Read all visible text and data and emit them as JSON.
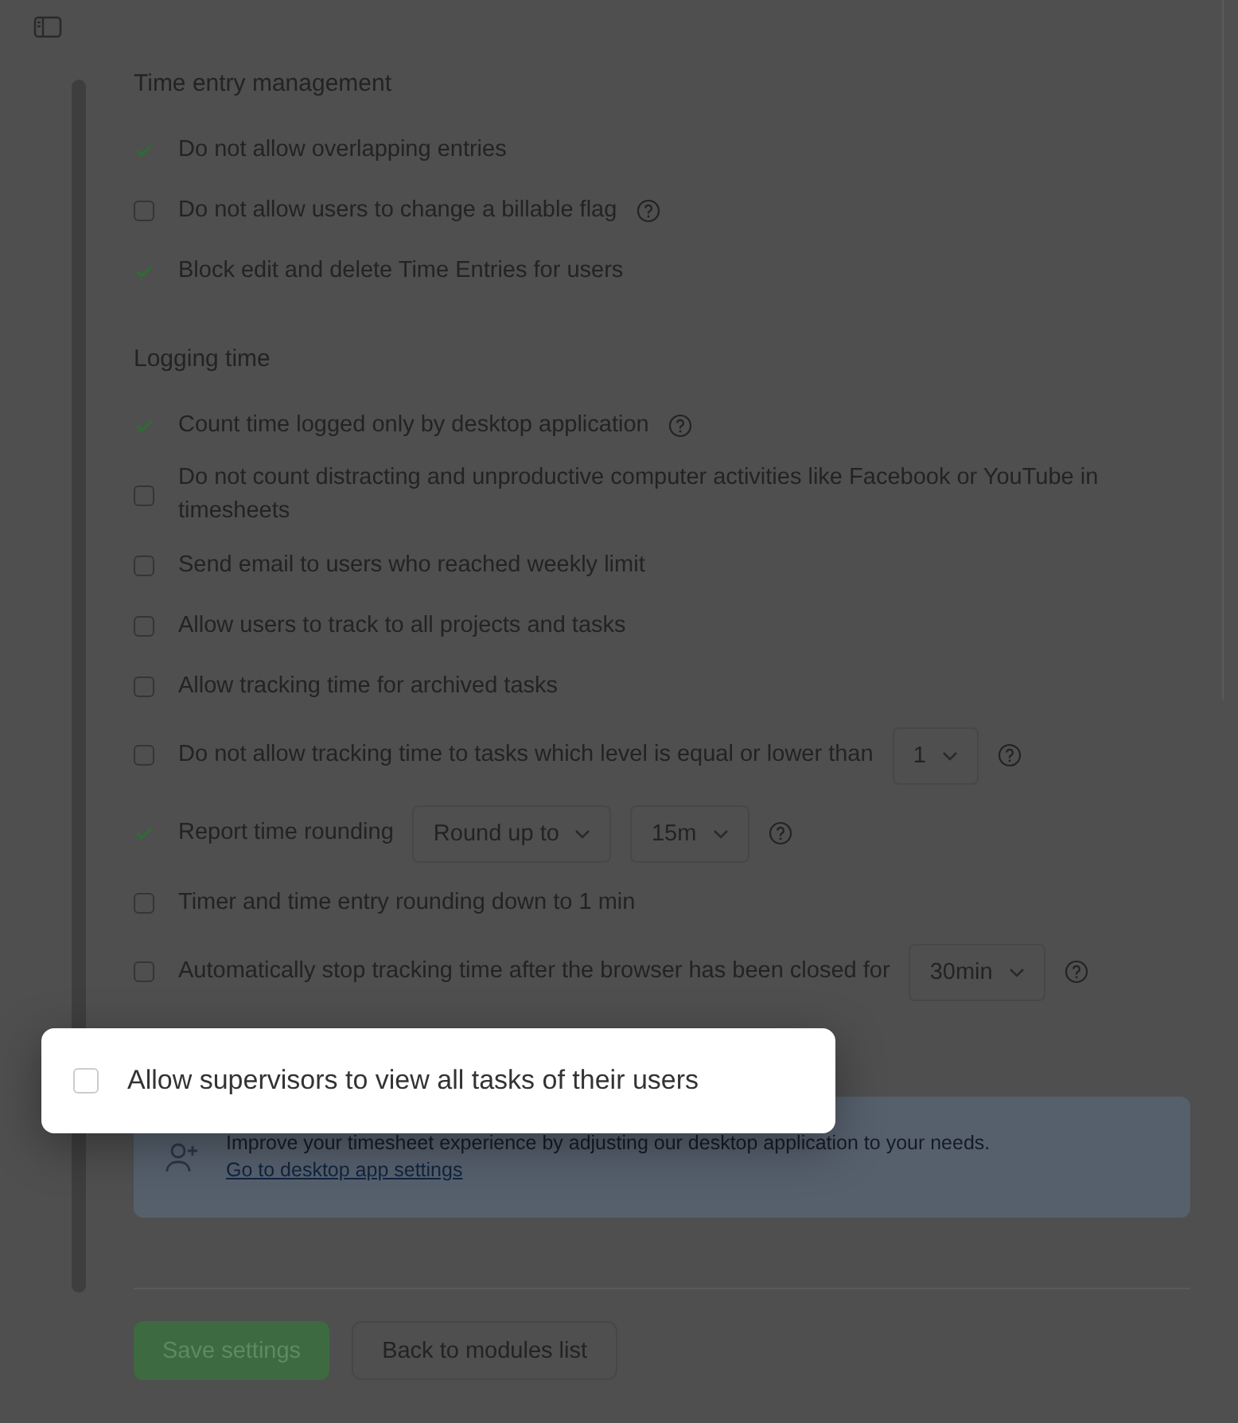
{
  "sections": [
    {
      "title": "Time entry management",
      "items": [
        {
          "label": "Do not allow overlapping entries",
          "checked": true
        },
        {
          "label": "Do not allow users to change a billable flag",
          "checked": false,
          "help": true
        },
        {
          "label": "Block edit and delete Time Entries for users",
          "checked": true
        }
      ]
    },
    {
      "title": "Logging time",
      "items": [
        {
          "label": "Count time logged only by desktop application",
          "checked": true,
          "help": true
        },
        {
          "label": "Do not count distracting and unproductive computer activities like Facebook or YouTube in timesheets",
          "checked": false
        },
        {
          "label": "Send email to users who reached weekly limit",
          "checked": false
        },
        {
          "label": "Allow users to track to all projects and tasks",
          "checked": false
        },
        {
          "label": "Allow tracking time for archived tasks",
          "checked": false
        },
        {
          "label": "Do not allow tracking time to tasks which level is equal or lower than",
          "checked": false,
          "selects": [
            "1"
          ],
          "help": true
        },
        {
          "label": "Report time rounding",
          "checked": true,
          "selects": [
            "Round up to",
            "15m"
          ],
          "help": true
        },
        {
          "label": "Timer and time entry rounding down to 1 min",
          "checked": false
        },
        {
          "label": "Automatically stop tracking time after the browser has been closed for",
          "checked": false,
          "selects": [
            "30min"
          ],
          "help": true
        }
      ]
    }
  ],
  "popup": {
    "label": "Allow supervisors to view all tasks of their users",
    "checked": false
  },
  "banner": {
    "text": "Improve your timesheet experience by adjusting our desktop application to your needs.",
    "link": "Go to desktop app settings"
  },
  "buttons": [
    {
      "label": "Save settings",
      "kind": "primary"
    },
    {
      "label": "Back to modules list",
      "kind": "secondary"
    }
  ]
}
